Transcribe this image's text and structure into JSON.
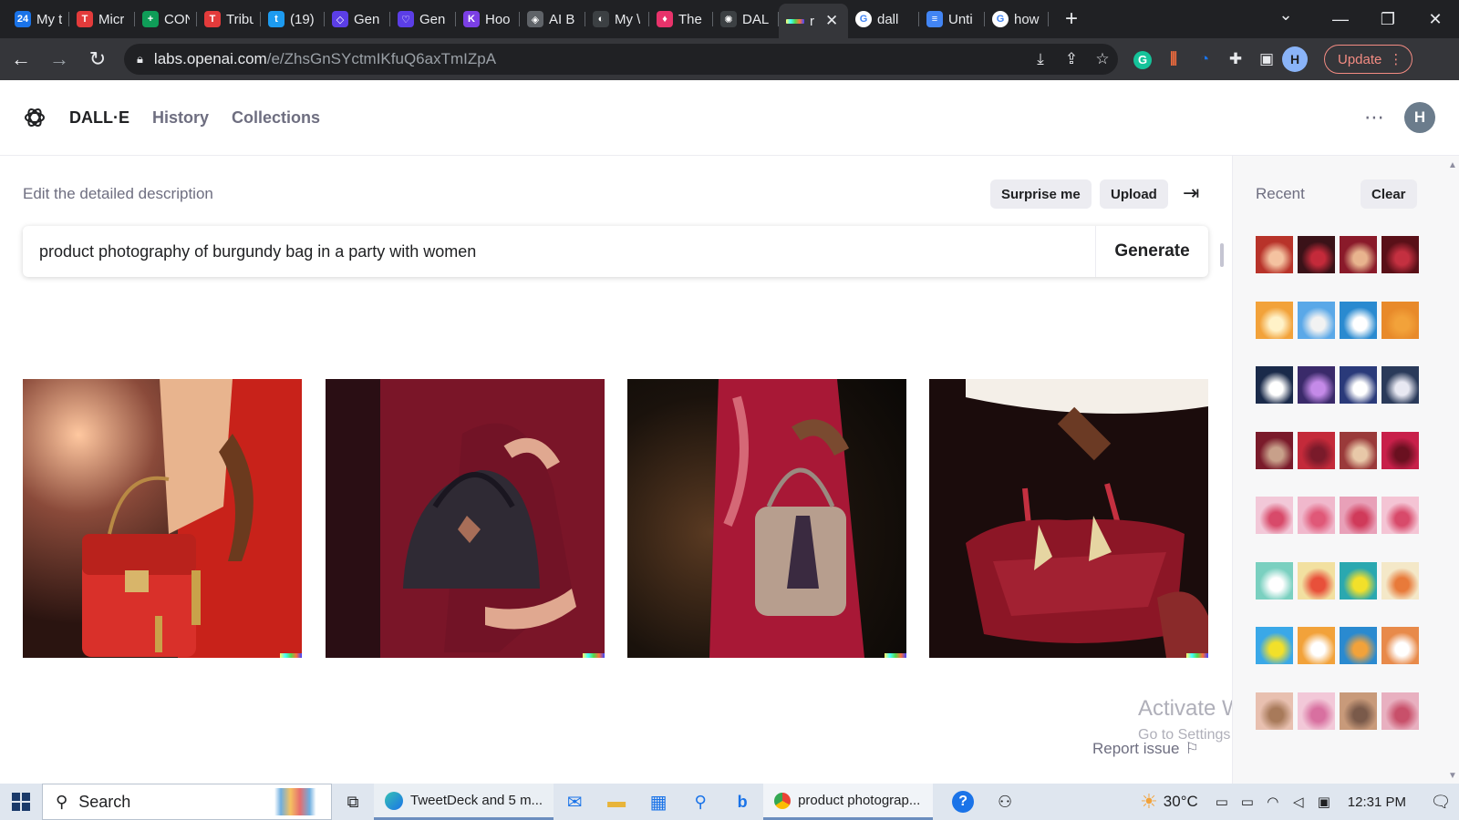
{
  "browser": {
    "tabs": [
      {
        "label": "My t",
        "fav": "24",
        "color": "#1a73e8",
        "icon": "news24-icon"
      },
      {
        "label": "Micr",
        "fav": "T",
        "color": "#e33b3b",
        "icon": "tribune-icon"
      },
      {
        "label": "CON",
        "fav": "+",
        "color": "#0f9d58",
        "icon": "green-plus-icon"
      },
      {
        "label": "Tribu",
        "fav": "T",
        "color": "#e33b3b",
        "icon": "tribune-icon"
      },
      {
        "label": "(19)",
        "fav": "t",
        "color": "#1d9bf0",
        "icon": "twitter-icon"
      },
      {
        "label": "Gen",
        "fav": "◇",
        "color": "#5b3ee6",
        "icon": "gen-icon"
      },
      {
        "label": "Gen",
        "fav": "♡",
        "color": "#5b3ee6",
        "icon": "gen-heart-icon"
      },
      {
        "label": "Hoo",
        "fav": "K",
        "color": "#7b3fe4",
        "icon": "k-icon"
      },
      {
        "label": "AI B",
        "fav": "◈",
        "color": "#5f6368",
        "icon": "ai-icon"
      },
      {
        "label": "My \\",
        "fav": "◐",
        "color": "#3c4043",
        "icon": "globe-icon"
      },
      {
        "label": "The",
        "fav": "♦",
        "color": "#e8336b",
        "icon": "red-diamond-icon"
      },
      {
        "label": "DAL",
        "fav": "✺",
        "color": "#3c4043",
        "icon": "openai-icon"
      },
      {
        "label": "r",
        "fav": "",
        "color": "#3c4043",
        "icon": "dalle-tab-icon",
        "active": true
      },
      {
        "label": "dall",
        "fav": "G",
        "color": "#ffffff",
        "icon": "google-icon"
      },
      {
        "label": "Unti",
        "fav": "≡",
        "color": "#4285f4",
        "icon": "docs-icon"
      },
      {
        "label": "how",
        "fav": "G",
        "color": "#ffffff",
        "icon": "google-icon"
      }
    ],
    "url_host": "labs.openai.com",
    "url_path": "/e/ZhsGnSYctmIKfuQ6axTmIZpA",
    "profile_initial": "H",
    "update_label": "Update"
  },
  "app": {
    "brand": "DALL·E",
    "nav": [
      "History",
      "Collections"
    ],
    "avatar_initial": "H"
  },
  "editor": {
    "heading": "Edit the detailed description",
    "surprise_label": "Surprise me",
    "upload_label": "Upload",
    "prompt": "product photography of burgundy bag in a party with women",
    "generate_label": "Generate"
  },
  "sidebar": {
    "title": "Recent",
    "clear_label": "Clear"
  },
  "footer": {
    "report_label": "Report issue",
    "watermark_line1": "Activate Windows",
    "watermark_line2": "Go to Settings to activate Windows."
  },
  "taskbar": {
    "search_label": "Search",
    "tweetdeck_label": "TweetDeck and 5 m...",
    "chrome_label": "product photograp...",
    "temperature": "30°C",
    "time": "12:31 PM"
  },
  "colors": {
    "accent": "#202123",
    "chrome_dark": "#202124",
    "sidebar_bg": "#f7f7f8",
    "update_red": "#f28b82"
  }
}
